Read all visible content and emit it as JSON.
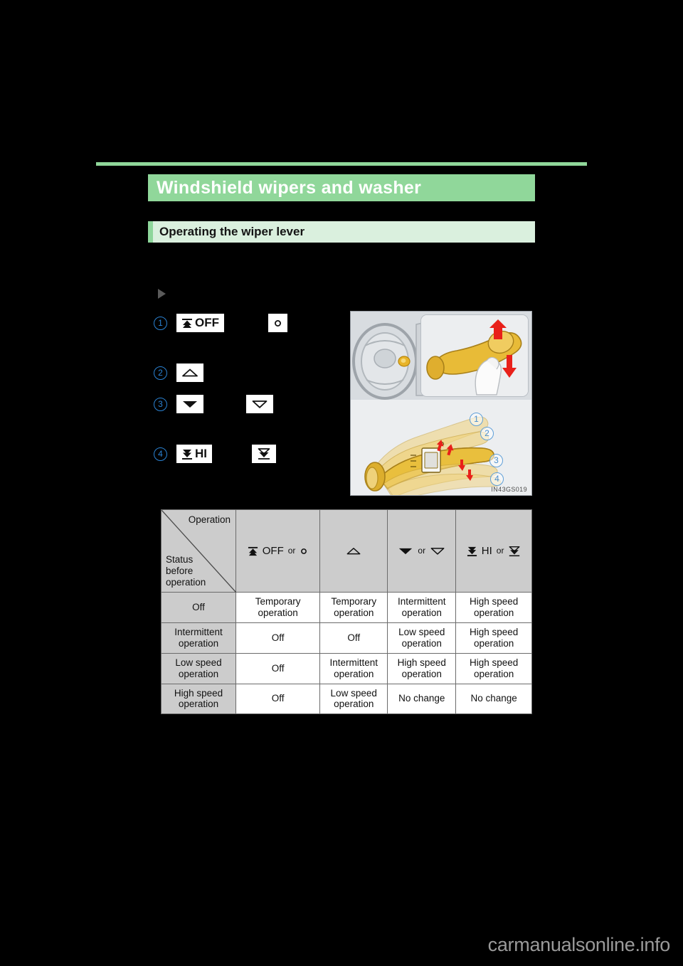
{
  "page": {
    "background_color": "#000000",
    "accent_green": "#90d79a",
    "accent_green_light": "#daf0de",
    "callout_blue": "#2b83d4"
  },
  "header": {
    "title": "Windshield wipers and washer",
    "subsection": "Operating the wiper lever"
  },
  "list": {
    "bullet_icon": "play-triangle-icon",
    "items": [
      {
        "number": "1",
        "label": "OFF",
        "icon": "wiper-off-icon",
        "alt_icon": "small-circle-icon"
      },
      {
        "number": "2",
        "label": "",
        "icon": "triangle-up-outline-icon",
        "alt_icon": ""
      },
      {
        "number": "3",
        "label": "",
        "icon": "triangle-down-solid-icon",
        "alt_icon": "triangle-down-outline-icon"
      },
      {
        "number": "4",
        "label": "HI",
        "icon": "wiper-hi-icon",
        "alt_icon": "wiper-hi-underline-icon"
      }
    ]
  },
  "illustration": {
    "image_code": "IN43GS019",
    "description": "Steering column wiper lever with up/down movement arrows",
    "callouts": [
      "1",
      "2",
      "3",
      "4"
    ]
  },
  "table": {
    "corner_column_label": "Operation",
    "corner_row_label": "Status\nbefore\noperation",
    "corner_row_label_lines": [
      "Status",
      "before",
      "operation"
    ],
    "or_label": "or",
    "columns": [
      {
        "label": "OFF",
        "icon": "wiper-off-icon",
        "alt_icon": "small-circle-icon",
        "has_or": true
      },
      {
        "label": "",
        "icon": "triangle-up-outline-icon",
        "alt_icon": "",
        "has_or": false
      },
      {
        "label": "",
        "icon": "triangle-down-solid-icon",
        "alt_icon": "triangle-down-outline-icon",
        "has_or": true
      },
      {
        "label": "HI",
        "icon": "wiper-hi-icon",
        "alt_icon": "wiper-hi-underline-icon",
        "has_or": true
      }
    ],
    "rows": [
      {
        "status": "Off",
        "status_lines": [
          "Off"
        ],
        "cells": [
          [
            "Temporary",
            "operation"
          ],
          [
            "Temporary",
            "operation"
          ],
          [
            "Intermittent",
            "operation"
          ],
          [
            "High speed",
            "operation"
          ]
        ]
      },
      {
        "status": "Intermittent operation",
        "status_lines": [
          "Intermittent",
          "operation"
        ],
        "cells": [
          [
            "Off"
          ],
          [
            "Off"
          ],
          [
            "Low speed",
            "operation"
          ],
          [
            "High speed",
            "operation"
          ]
        ]
      },
      {
        "status": "Low speed operation",
        "status_lines": [
          "Low speed",
          "operation"
        ],
        "cells": [
          [
            "Off"
          ],
          [
            "Intermittent",
            "operation"
          ],
          [
            "High speed",
            "operation"
          ],
          [
            "High speed",
            "operation"
          ]
        ]
      },
      {
        "status": "High speed operation",
        "status_lines": [
          "High speed",
          "operation"
        ],
        "cells": [
          [
            "Off"
          ],
          [
            "Low speed",
            "operation"
          ],
          [
            "No change"
          ],
          [
            "No change"
          ]
        ]
      }
    ]
  },
  "watermark": {
    "text": "carmanualsonline.info"
  }
}
